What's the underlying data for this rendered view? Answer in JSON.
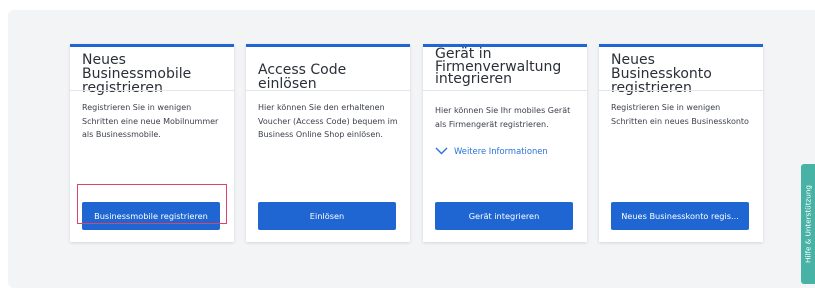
{
  "cards": [
    {
      "title_line1": "Neues Businessmobile",
      "title_line2": "registrieren",
      "desc_line1": "Registrieren Sie in wenigen",
      "desc_line2": "Schritten eine neue Mobilnummer",
      "desc_line3": "als Businessmobile.",
      "button": "Businessmobile registrieren"
    },
    {
      "title": "Access Code einlösen",
      "desc_line1": "Hier können Sie den erhaltenen",
      "desc_line2": "Voucher (Access Code) bequem im",
      "desc_line3": "Business Online Shop einlösen.",
      "button": "Einlösen"
    },
    {
      "title_line1": "Gerät in",
      "title_line2": "Firmenverwaltung",
      "title_line3": "integrieren",
      "desc_line1": "Hier können Sie Ihr mobiles Gerät",
      "desc_line2": "als Firmengerät registrieren.",
      "link": "Weitere Informationen",
      "link_icon": "chevron-down-icon",
      "button": "Gerät integrieren"
    },
    {
      "title_line1": "Neues Businesskonto",
      "title_line2": "registrieren",
      "desc_line1": "Registrieren Sie in wenigen",
      "desc_line2": "Schritten ein neues Businesskonto",
      "button": "Neues Businesskonto regis..."
    }
  ],
  "help_tab": "Hilfe & Unterstützung",
  "colors": {
    "accent": "#1f66d3",
    "panel": "#f3f4f6",
    "highlight": "#d94468",
    "help_tab": "#49b2a6",
    "link": "#2a73d8"
  }
}
